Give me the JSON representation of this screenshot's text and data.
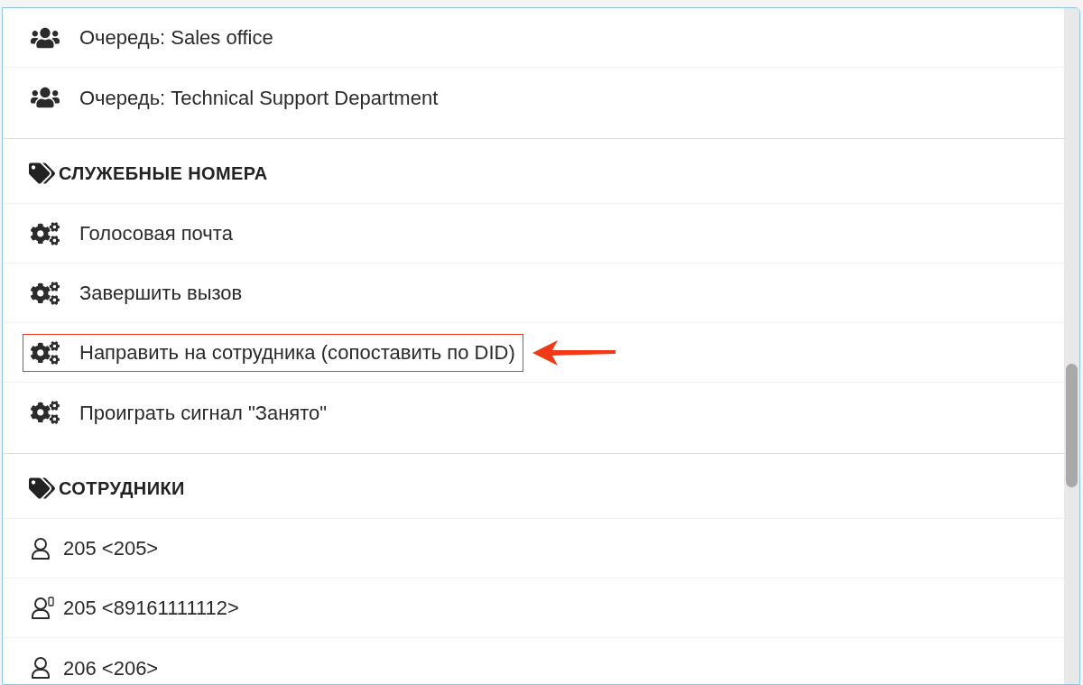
{
  "list": {
    "groups": [
      {
        "items": [
          {
            "kind": "queue",
            "label": "Очередь: Sales office",
            "highlighted": false
          },
          {
            "kind": "queue",
            "label": "Очередь: Technical Support Department",
            "highlighted": false
          }
        ]
      },
      {
        "title": "СЛУЖЕБНЫЕ НОМЕРА",
        "items": [
          {
            "kind": "service",
            "label": "Голосовая почта",
            "highlighted": false
          },
          {
            "kind": "service",
            "label": "Завершить вызов",
            "highlighted": false
          },
          {
            "kind": "service",
            "label": "Направить на сотрудника (сопоставить по DID)",
            "highlighted": true
          },
          {
            "kind": "service",
            "label": "Проиграть сигнал \"Занято\"",
            "highlighted": false
          }
        ]
      },
      {
        "title": "СОТРУДНИКИ",
        "items": [
          {
            "kind": "user",
            "label": "205 <205>",
            "highlighted": false
          },
          {
            "kind": "mobile_user",
            "label": "205 <89161111112>",
            "highlighted": false
          },
          {
            "kind": "user",
            "label": "206 <206>",
            "highlighted": false
          }
        ]
      }
    ]
  }
}
